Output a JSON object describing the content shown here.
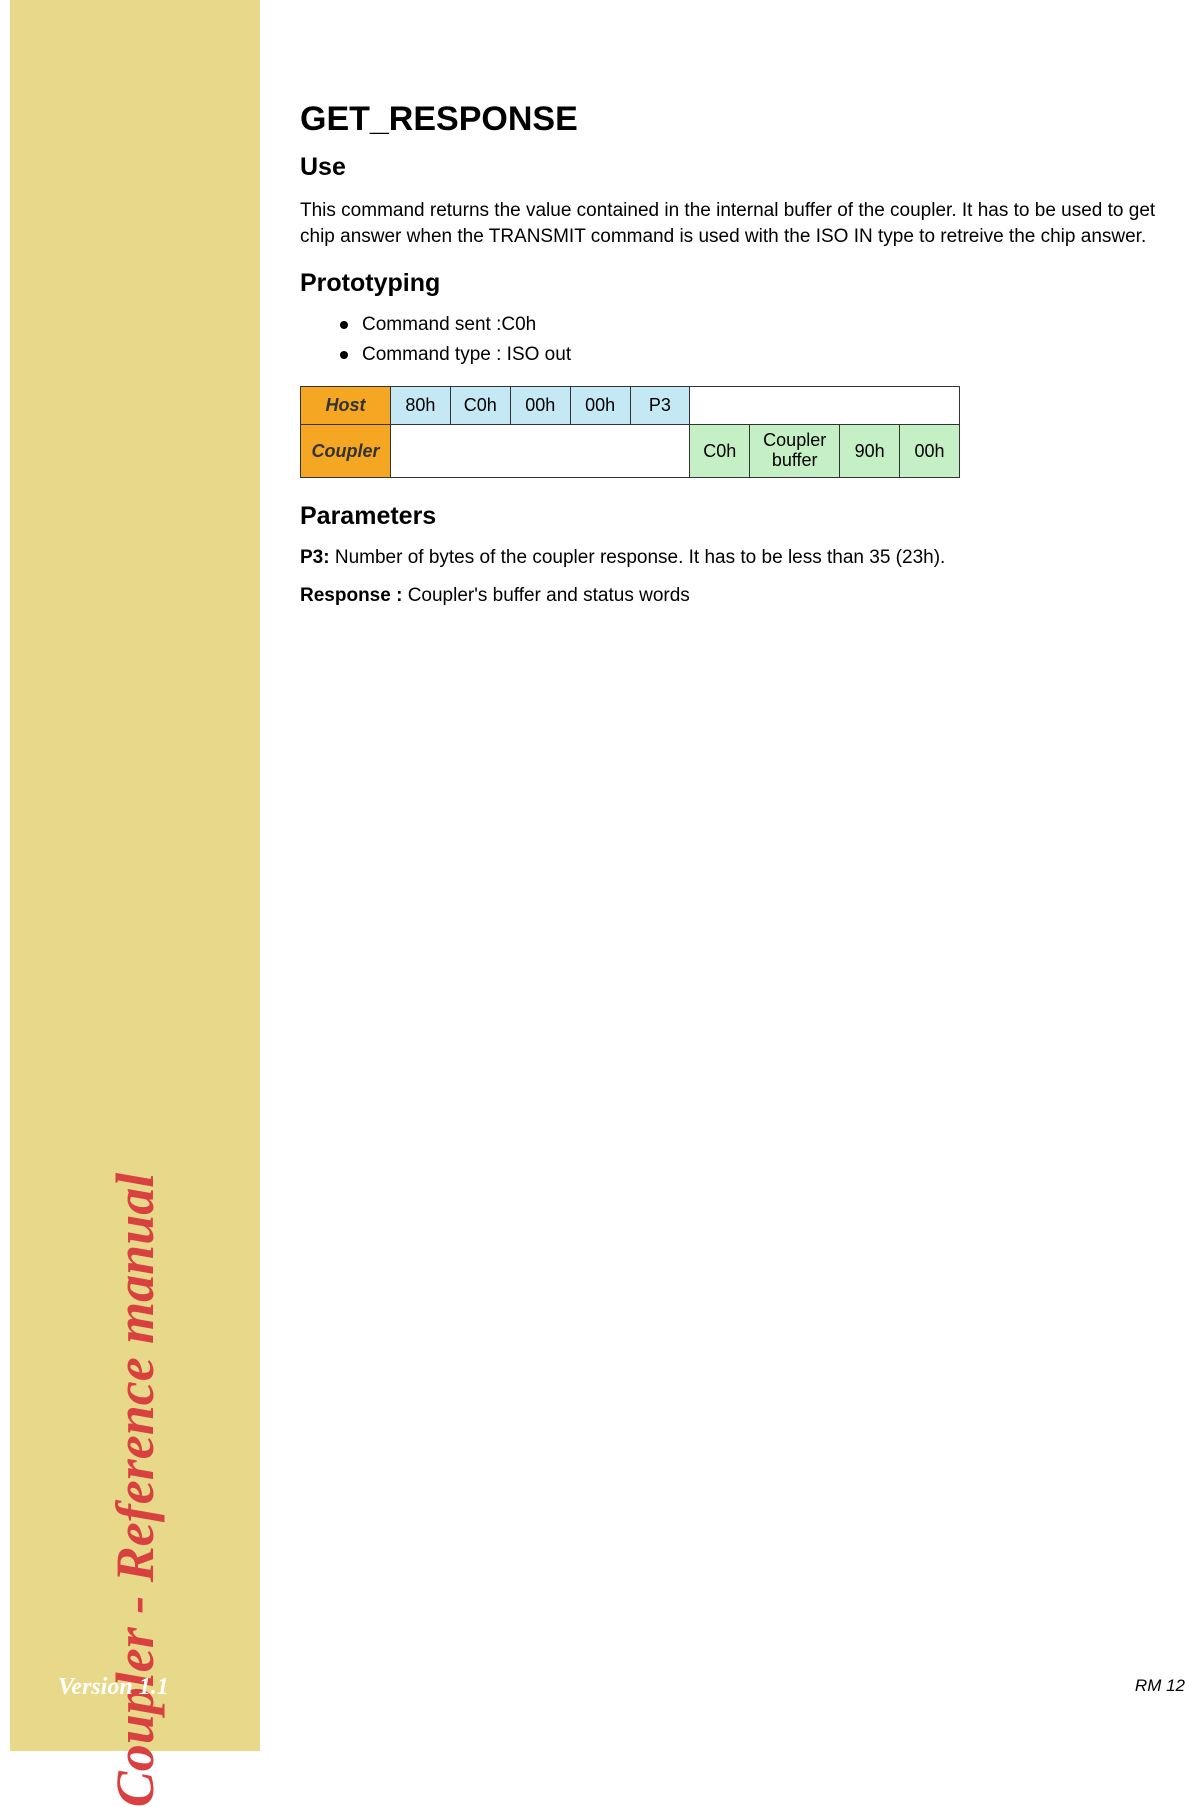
{
  "sidebar": {
    "title": "Coupler - Reference manual",
    "version": "Version 1.1"
  },
  "page": {
    "title": "GET_RESPONSE",
    "footer": "RM 12"
  },
  "sections": {
    "use": {
      "heading": "Use",
      "text": "This command returns the value contained in the internal buffer of the coupler. It has to be used to get chip answer when the TRANSMIT command is used with the ISO IN type to retreive the chip answer."
    },
    "prototyping": {
      "heading": "Prototyping",
      "bullets": [
        "Command sent :C0h",
        "Command type : ISO out"
      ],
      "table": {
        "host_label": "Host",
        "host_cells": [
          "80h",
          "C0h",
          "00h",
          "00h",
          "P3"
        ],
        "coupler_label": "Coupler",
        "coupler_cells": [
          "C0h",
          "Coupler buffer",
          "90h",
          "00h"
        ]
      }
    },
    "parameters": {
      "heading": "Parameters",
      "p3_label": "P3:",
      "p3_text": " Number of bytes of the coupler response. It has to be less than 35 (23h).",
      "response_label": "Response :",
      "response_text": " Coupler's buffer and status words"
    }
  }
}
